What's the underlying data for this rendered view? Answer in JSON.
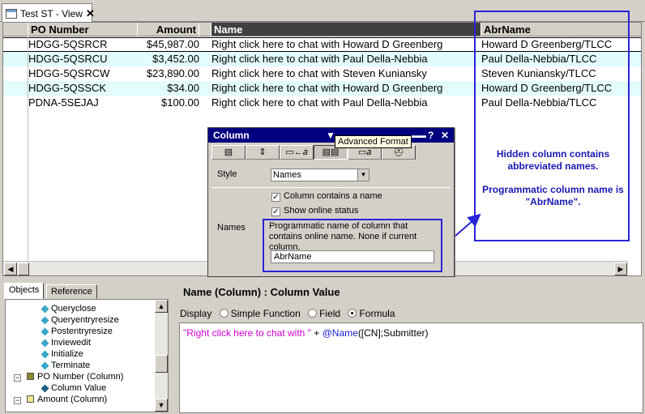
{
  "tab": {
    "title": "Test ST - View",
    "close": "✕"
  },
  "view": {
    "columns": [
      "PO Number",
      "Amount",
      "Name",
      "AbrName"
    ],
    "rows": [
      {
        "po": "HDGG-5QSRCR",
        "amount": "$45,987.00",
        "name": "Right click here to chat with Howard D Greenberg",
        "abr": "Howard D Greenberg/TLCC"
      },
      {
        "po": "HDGG-5QSRCU",
        "amount": "$3,452.00",
        "name": "Right click here to chat with Paul Della-Nebbia",
        "abr": "Paul Della-Nebbia/TLCC"
      },
      {
        "po": "HDGG-5QSRCW",
        "amount": "$23,890.00",
        "name": "Right click here to chat with Steven Kuniansky",
        "abr": "Steven Kuniansky/TLCC"
      },
      {
        "po": "HDGG-5QSSCK",
        "amount": "$34.00",
        "name": "Right click here to chat with Howard D Greenberg",
        "abr": "Howard D Greenberg/TLCC"
      },
      {
        "po": "PDNA-5SEJAJ",
        "amount": "$100.00",
        "name": "Right click here to chat with Paul Della-Nebbia",
        "abr": "Paul Della-Nebbia/TLCC"
      }
    ]
  },
  "annotation": {
    "line1": "Hidden column contains abbreviated names.",
    "line2": "Programmatic column name is \"AbrName\"."
  },
  "palette": {
    "title": "Column",
    "tooltip": "Advanced Format",
    "style_label": "Style",
    "style_value": "Names",
    "names_label": "Names",
    "check1": "Column contains a name",
    "check2": "Show online status",
    "help": "Programmatic name of column that contains online name. None if current column.",
    "prog_value": "AbrName"
  },
  "objects": {
    "tabs": [
      "Objects",
      "Reference"
    ],
    "items": [
      "Queryclose",
      "Queryentryresize",
      "Postentryresize",
      "Inviewedit",
      "Initialize",
      "Terminate",
      "PO Number (Column)",
      "Column Value",
      "Amount (Column)"
    ]
  },
  "editor": {
    "title": "Name (Column) : Column Value",
    "display_label": "Display",
    "options": [
      "Simple Function",
      "Field",
      "Formula"
    ],
    "formula_string": "\"Right click here to chat with \"",
    "formula_op": " + ",
    "formula_fn": "@Name",
    "formula_args": "([CN];Submitter)"
  },
  "colors": {
    "annotation": "#2a24d8",
    "alt_row": "#e2fbfb",
    "title_bar": "#000080"
  }
}
